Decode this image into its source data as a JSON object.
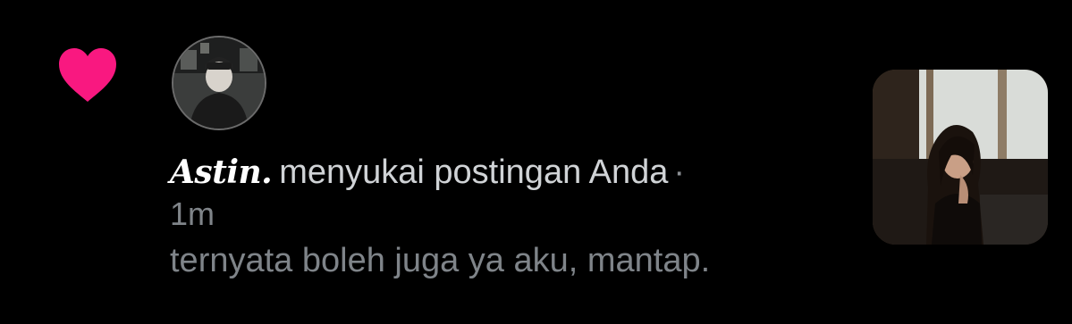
{
  "notification": {
    "type_icon": "heart-icon",
    "accent_color": "#f91880",
    "avatar": "user-avatar",
    "username": "Astin.",
    "action_text": "menyukai postingan Anda",
    "separator": "·",
    "time": "1m",
    "post_text": "ternyata boleh juga ya aku, mantap.",
    "thumbnail": "post-photo-thumbnail"
  }
}
